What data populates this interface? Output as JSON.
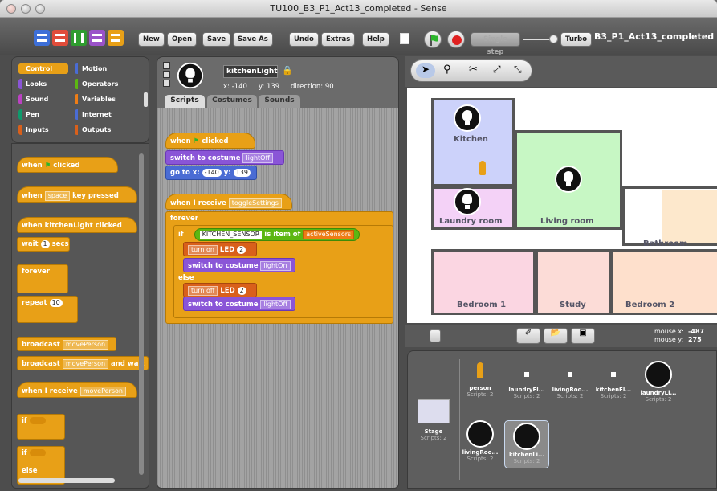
{
  "window": {
    "title": "TU100_B3_P1_Act13_completed - Sense",
    "project_name": "B3_P1_Act13_completed"
  },
  "toolbar": {
    "new": "New",
    "open": "Open",
    "save": "Save",
    "save_as": "Save As",
    "undo": "Undo",
    "extras": "Extras",
    "help": "Help",
    "single_step": "Single step",
    "turbo": "Turbo"
  },
  "categories": [
    "Control",
    "Motion",
    "Looks",
    "Operators",
    "Sound",
    "Variables",
    "Pen",
    "Internet",
    "Inputs",
    "Outputs"
  ],
  "palette": {
    "when_clicked": "when",
    "when_clicked2": "clicked",
    "when_key": "when",
    "key_value": "space",
    "key_pressed": "key pressed",
    "when_sprite_clicked": "when kitchenLight clicked",
    "wait": "wait",
    "wait_value": "1",
    "secs": "secs",
    "forever": "forever",
    "repeat": "repeat",
    "repeat_value": "10",
    "broadcast": "broadcast",
    "broadcast_msg": "movePerson",
    "broadcast_wait": "broadcast",
    "broadcast_wait_msg": "movePerson",
    "and_wait": "and wait",
    "when_receive": "when I receive",
    "receive_msg": "movePerson",
    "if": "if",
    "if2": "if",
    "else": "else"
  },
  "sprite": {
    "name": "kitchenLight",
    "x_label": "x: -140",
    "y_label": "y: 139",
    "direction": "direction: 90"
  },
  "tabs": {
    "scripts": "Scripts",
    "costumes": "Costumes",
    "sounds": "Sounds"
  },
  "script": {
    "when": "when",
    "clicked": "clicked",
    "switch": "switch to costume",
    "costume_off": "lightOff",
    "goto": "go to x:",
    "gx": "-140",
    "y": "y:",
    "gy": "139",
    "when_receive": "when I receive",
    "msg": "toggleSettings",
    "forever": "forever",
    "if": "if",
    "sensor": "KITCHEN_SENSOR",
    "is_item": "is item of",
    "list": "activeSensors",
    "turn_on": "turn on",
    "led": "LED",
    "led_num": "2",
    "switch_on": "switch to costume",
    "costume_on": "lightOn",
    "else": "else",
    "turn_off": "turn off",
    "led2": "LED",
    "led_num2": "2",
    "switch_off": "switch to costume",
    "costume_off2": "lightOff"
  },
  "stage": {
    "rooms": {
      "kitchen": "Kitchen",
      "laundry": "Laundry room",
      "living": "Living room",
      "bathroom": "Bathroom",
      "bedroom1": "Bedroom 1",
      "study": "Study",
      "bedroom2": "Bedroom 2"
    }
  },
  "mouse": {
    "x_label": "mouse x:",
    "x": "-487",
    "y_label": "mouse y:",
    "y": "275"
  },
  "sprites": [
    {
      "name": "person",
      "sub": "Scripts: 2"
    },
    {
      "name": "laundryFl...",
      "sub": "Scripts: 2"
    },
    {
      "name": "livingRoo...",
      "sub": "Scripts: 2"
    },
    {
      "name": "kitchenFl...",
      "sub": "Scripts: 2"
    },
    {
      "name": "laundryLi...",
      "sub": "Scripts: 2"
    },
    {
      "name": "livingRoo...",
      "sub": "Scripts: 2"
    },
    {
      "name": "kitchenLi...",
      "sub": "Scripts: 2"
    }
  ],
  "stage_thumb": {
    "name": "Stage",
    "sub": "Scripts: 2"
  },
  "colors": {
    "control": "#e8a017",
    "motion": "#4a6cd4",
    "looks": "#8a55d7",
    "operators": "#5cb712",
    "sound": "#bb42c3",
    "variables": "#ee7d16",
    "pen": "#0e9a6c",
    "internet": "#4a6cd4",
    "inputs": "#d9601b",
    "outputs": "#d9601b"
  }
}
